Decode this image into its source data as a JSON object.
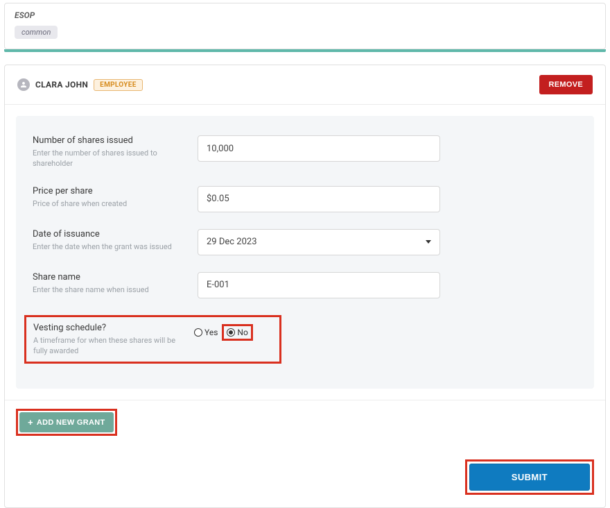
{
  "top": {
    "title": "ESOP",
    "tag": "common"
  },
  "person": {
    "name": "CLARA JOHN",
    "role_badge": "EMPLOYEE"
  },
  "buttons": {
    "remove": "REMOVE",
    "add_grant": "ADD NEW GRANT",
    "submit": "SUBMIT"
  },
  "form": {
    "shares": {
      "label": "Number of shares issued",
      "help": "Enter the number of shares issued to shareholder",
      "value": "10,000"
    },
    "price": {
      "label": "Price per share",
      "help": "Price of share when created",
      "value": "$0.05"
    },
    "date": {
      "label": "Date of issuance",
      "help": "Enter the date when the grant was issued",
      "value": "29 Dec 2023"
    },
    "share_name": {
      "label": "Share name",
      "help": "Enter the share name when issued",
      "value": "E-001"
    },
    "vesting": {
      "label": "Vesting schedule?",
      "help": "A timeframe for when these shares will be fully awarded",
      "options": {
        "yes": "Yes",
        "no": "No"
      },
      "selected": "no"
    }
  }
}
